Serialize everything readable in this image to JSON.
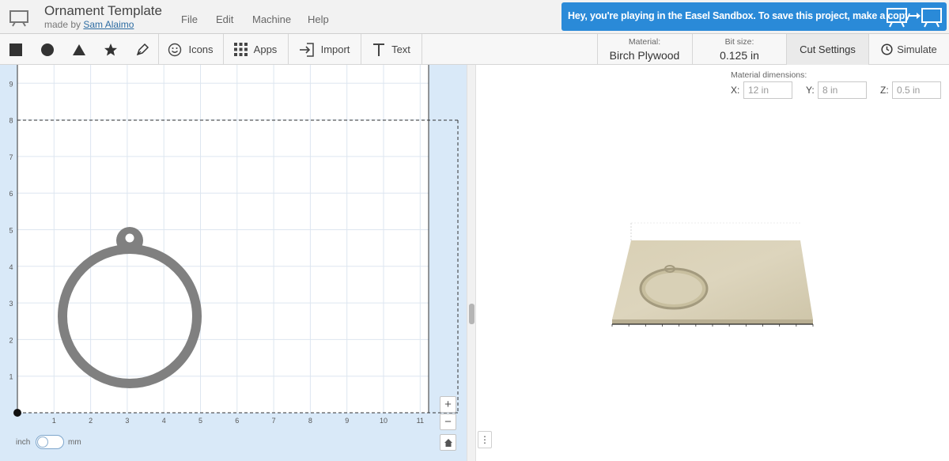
{
  "header": {
    "title": "Ornament Template",
    "made_by_prefix": "made by",
    "author": "Sam Alaimo",
    "menu": [
      "File",
      "Edit",
      "Machine",
      "Help"
    ],
    "sandbox_banner": "Hey, you're playing in the Easel Sandbox. To save this project, make a copy"
  },
  "toolbar": {
    "shape_tools": [
      "square-icon",
      "circle-icon",
      "triangle-icon",
      "star-icon",
      "pen-icon"
    ],
    "icons_label": "Icons",
    "apps_label": "Apps",
    "import_label": "Import",
    "text_label": "Text",
    "material_label": "Material:",
    "material_value": "Birch Plywood",
    "bit_label": "Bit size:",
    "bit_value": "0.125 in",
    "cut_settings_label": "Cut Settings",
    "simulate_label": "Simulate"
  },
  "material_dimensions": {
    "label": "Material dimensions:",
    "x_label": "X:",
    "x_value": "12 in",
    "y_label": "Y:",
    "y_value": "8 in",
    "z_label": "Z:",
    "z_value": "0.5 in"
  },
  "canvas": {
    "x_ticks": [
      "1",
      "2",
      "3",
      "4",
      "5",
      "6",
      "7",
      "8",
      "9",
      "10",
      "11"
    ],
    "y_ticks": [
      "1",
      "2",
      "3",
      "4",
      "5",
      "6",
      "7",
      "8",
      "9"
    ],
    "zoom_in": "+",
    "zoom_out": "−",
    "unit_left": "inch",
    "unit_right": "mm"
  },
  "preview": {
    "menu_glyph": "⋮"
  },
  "colors": {
    "banner": "#2a8ad8",
    "canvas_bg": "#d9e9f8",
    "ornament": "#808080",
    "wood": "#d8d0b6"
  }
}
